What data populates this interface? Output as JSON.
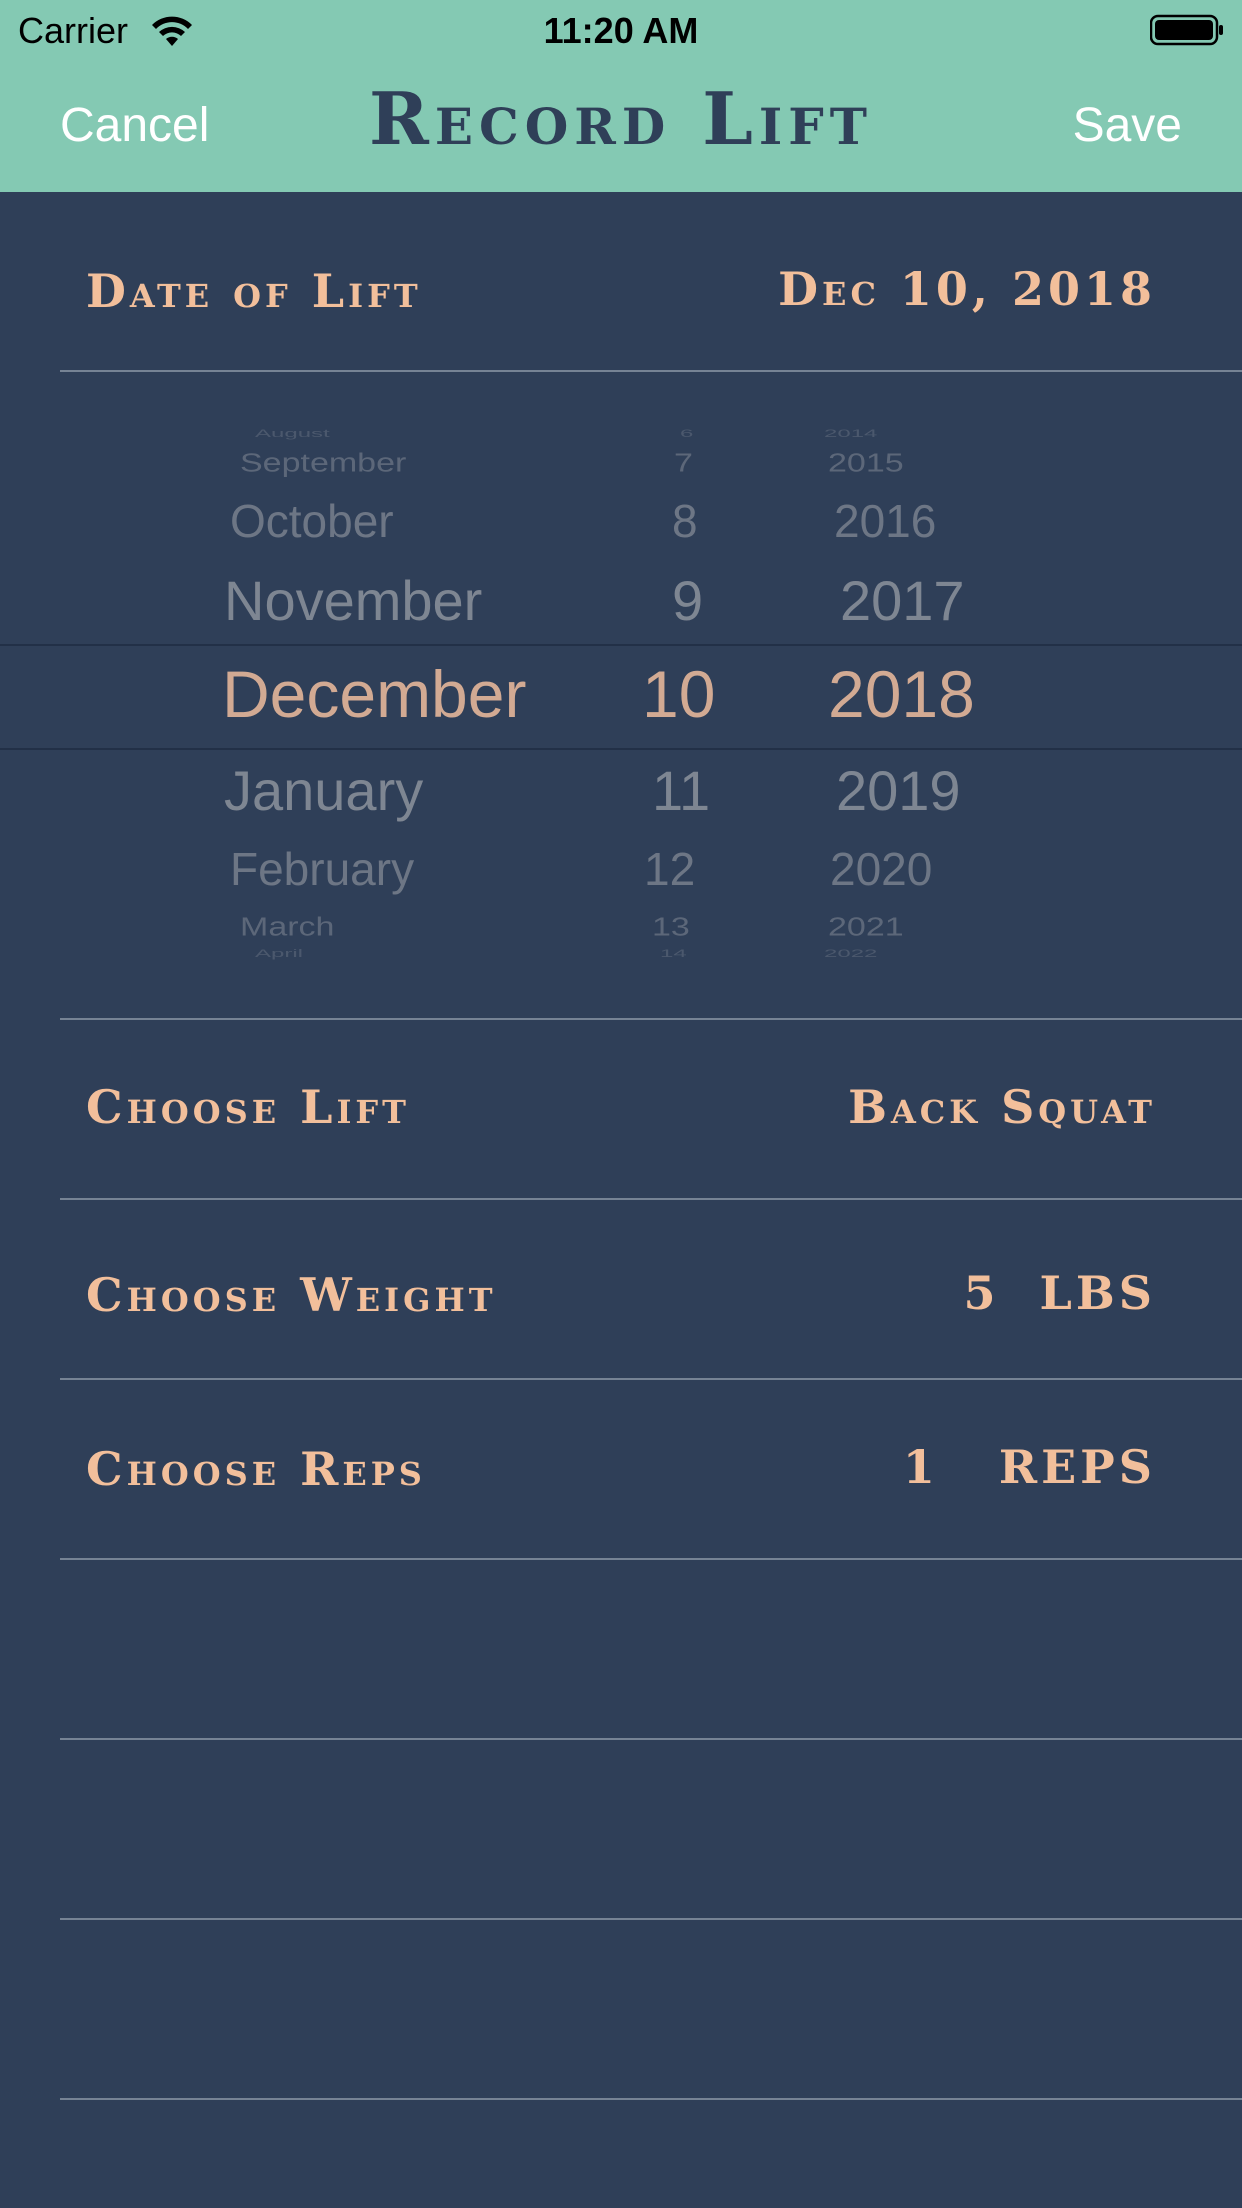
{
  "status_bar": {
    "carrier": "Carrier",
    "time": "11:20 AM",
    "wifi_icon": "wifi-icon",
    "battery_icon": "battery-full-icon"
  },
  "nav": {
    "cancel": "Cancel",
    "title": "Record Lift",
    "save": "Save"
  },
  "date_row": {
    "label": "Date of Lift",
    "value": "Dec 10, 2018"
  },
  "date_picker": {
    "months": [
      "August",
      "September",
      "October",
      "November",
      "December",
      "January",
      "February",
      "March",
      "April"
    ],
    "days": [
      "6",
      "7",
      "8",
      "9",
      "10",
      "11",
      "12",
      "13",
      "14"
    ],
    "years": [
      "2014",
      "2015",
      "2016",
      "2017",
      "2018",
      "2019",
      "2020",
      "2021",
      "2022"
    ],
    "selected": {
      "month": "December",
      "day": "10",
      "year": "2018"
    }
  },
  "lift_row": {
    "label": "Choose Lift",
    "value": "Back Squat"
  },
  "weight_row": {
    "label": "Choose Weight",
    "value_number": "5",
    "value_unit": "LBS"
  },
  "reps_row": {
    "label": "Choose Reps",
    "value_number": "1",
    "value_unit": "REPS"
  },
  "colors": {
    "nav_background": "#84c9b3",
    "page_background": "#2f3f58",
    "accent_text": "#f2bf9b",
    "title_text": "#2f3f58",
    "picker_selected": "#d2aa93",
    "picker_dim": "#a0a4ab"
  }
}
